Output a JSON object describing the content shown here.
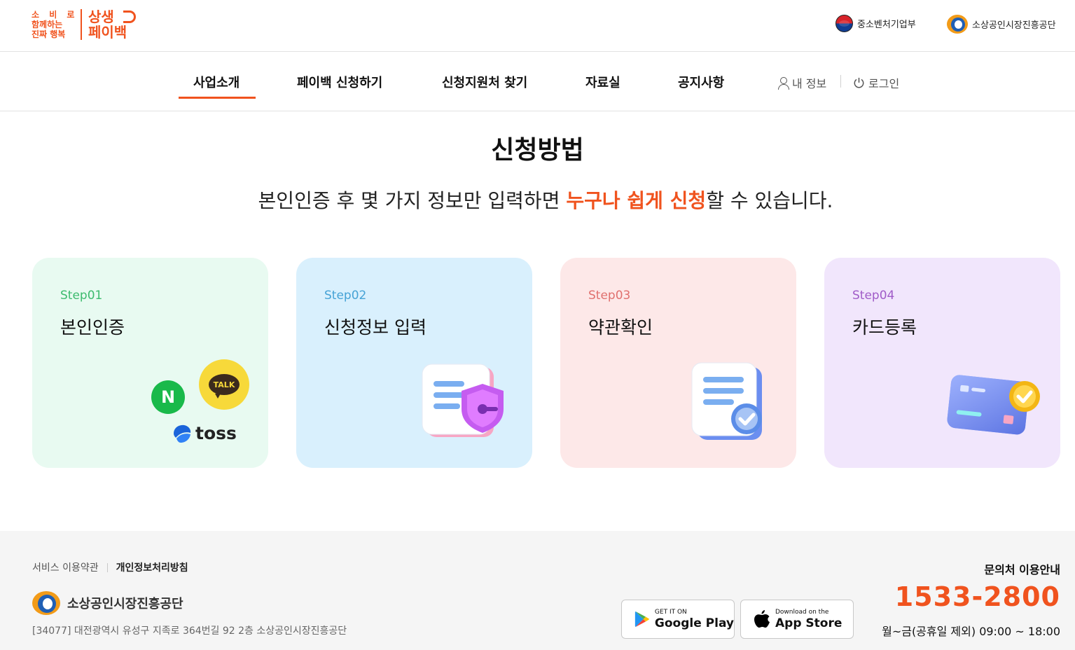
{
  "header": {
    "logo": {
      "small_line1": "소 비 로",
      "small_line2": "함께하는",
      "small_line3": "진짜 행복",
      "big_line1": "상생",
      "big_line2": "페이백"
    },
    "partners": [
      "중소벤처기업부",
      "소상공인시장진흥공단"
    ]
  },
  "nav": {
    "items": [
      "사업소개",
      "페이백 신청하기",
      "신청지원처 찾기",
      "자료실",
      "공지사항"
    ],
    "active_index": 0,
    "my_info": "내 정보",
    "login": "로그인"
  },
  "main": {
    "title": "신청방법",
    "subtitle_before": "본인인증 후 몇 가지 정보만 입력하면 ",
    "subtitle_highlight": "누구나 쉽게 신청",
    "subtitle_after": "할 수 있습니다.",
    "steps": [
      {
        "step": "Step01",
        "title": "본인인증",
        "providers": [
          "N",
          "TALK",
          "toss"
        ]
      },
      {
        "step": "Step02",
        "title": "신청정보 입력"
      },
      {
        "step": "Step03",
        "title": "약관확인"
      },
      {
        "step": "Step04",
        "title": "카드등록"
      }
    ]
  },
  "footer": {
    "links": [
      "서비스 이용약관",
      "개인정보처리방침"
    ],
    "org": "소상공인시장진흥공단",
    "address": "[34077] 대전광역시 유성구 지족로 364번길 92 2층 소상공인시장진흥공단",
    "google_play": {
      "small": "GET IT ON",
      "big": "Google Play"
    },
    "app_store": {
      "small": "Download on the",
      "big": "App Store"
    },
    "contact_title": "문의처 이용안내",
    "phone": "1533-2800",
    "hours": "월~금(공휴일 제외) 09:00 ~ 18:00"
  },
  "colors": {
    "accent": "#f0531e",
    "card1": "#e8faf1",
    "card2": "#d9f0fd",
    "card3": "#fde8e8",
    "card4": "#f1e6fc"
  }
}
